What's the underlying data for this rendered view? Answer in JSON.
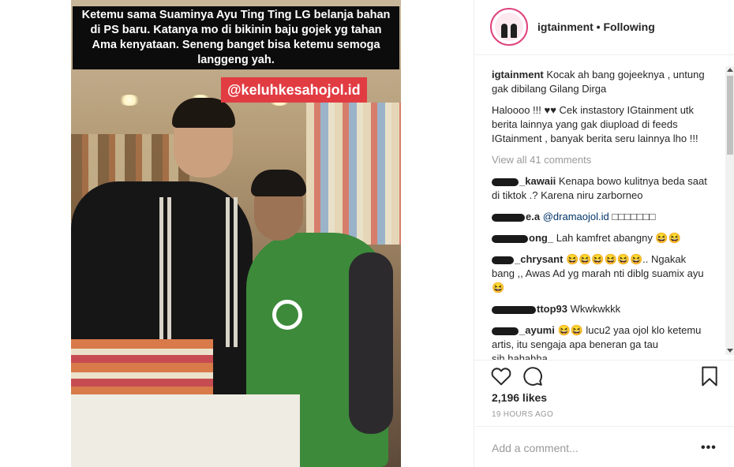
{
  "post": {
    "caption_overlay": "Ketemu sama Suaminya Ayu Ting Ting LG belanja bahan di PS baru. Katanya mo di bikinin baju gojek yg tahan Ama kenyataan. Seneng banget bisa ketemu semoga langgeng yah.",
    "handle_overlay": "@keluhkesahojol.id"
  },
  "header": {
    "username": "igtainment",
    "separator": "•",
    "follow_status": "Following"
  },
  "caption": {
    "username": "igtainment",
    "text1": "Kocak ah bang gojeeknya , untung gak dibilang Gilang Dirga",
    "text2": "Haloooo !!! ♥♥ Cek instastory IGtainment utk berita lainnya yang gak diupload di feeds IGtainment , banyak berita seru lainnya lho !!!"
  },
  "view_all": "View all 41 comments",
  "comments": [
    {
      "username": "_kawaii",
      "text": "Kenapa bowo kulitnya beda saat di tiktok .? Karena niru zarborneo"
    },
    {
      "username": "e.a",
      "mention": "@dramaojol.id",
      "text": "□□□□□□□"
    },
    {
      "username": "ong_",
      "text": "Lah kamfret abangny 😆😆"
    },
    {
      "username": "_chrysant",
      "text": "😆😆😆😆😆😆.. Ngakak bang ,, Awas Ad yg marah nti diblg suamix ayu😆"
    },
    {
      "username": "ttop93",
      "text": "Wkwkwkkk"
    },
    {
      "username": "_ayumi",
      "text": "😆😆 lucu2 yaa ojol klo ketemu artis, itu sengaja apa beneran ga tau sih.hahahha"
    }
  ],
  "actions": {
    "like_icon": "heart-icon",
    "comment_icon": "comment-icon",
    "save_icon": "bookmark-icon"
  },
  "likes": "2,196 likes",
  "timestamp": "19 HOURS AGO",
  "add_comment": {
    "placeholder": "Add a comment...",
    "more": "•••"
  },
  "colors": {
    "overlay_bg": "#0c0c0c",
    "handle_bg": "#e23c43",
    "avatar_ring": "#e0427c",
    "meta_gray": "#999999",
    "mention_blue": "#003569"
  }
}
